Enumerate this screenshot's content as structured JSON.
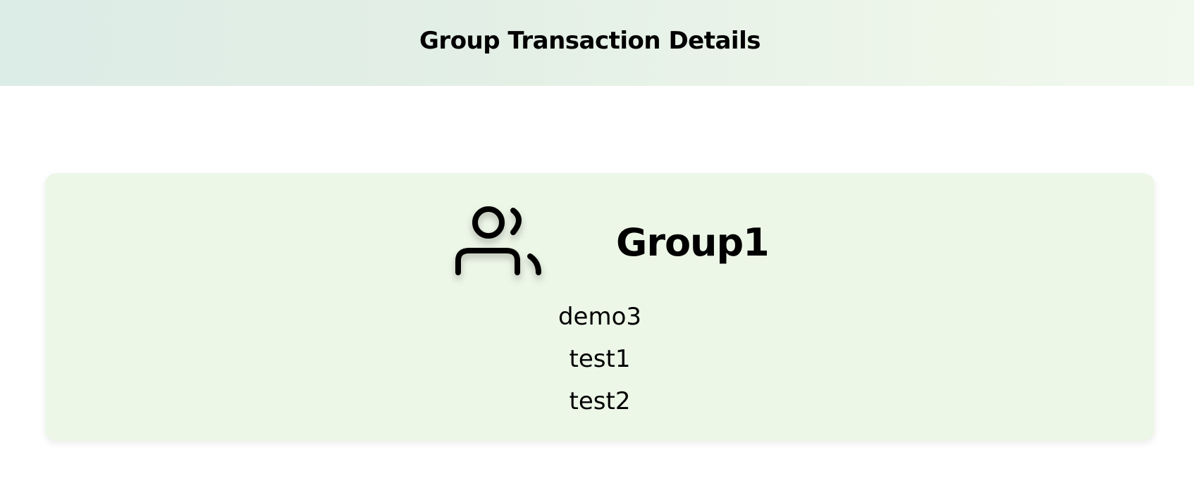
{
  "header": {
    "title": "Group Transaction Details"
  },
  "group": {
    "name": "Group1",
    "icon": "users-icon",
    "members": [
      "demo3",
      "test1",
      "test2"
    ]
  },
  "colors": {
    "card_background": "#edf7e8",
    "header_gradient_start": "#dcece6",
    "header_gradient_end": "#f1f8ee"
  }
}
